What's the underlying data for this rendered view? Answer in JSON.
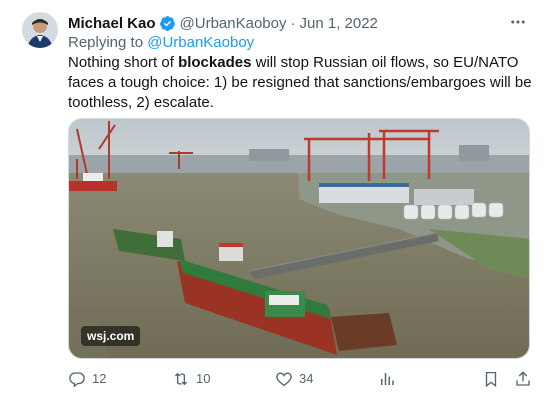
{
  "author": {
    "name": "Michael Kao",
    "handle": "@UrbanKaoboy",
    "separator": "·",
    "date": "Jun 1, 2022"
  },
  "reply": {
    "prefix": "Replying to",
    "mention": "@UrbanKaoboy"
  },
  "tweet": {
    "text_before": "Nothing short of ",
    "text_bold": "blockades",
    "text_after": " will stop Russian oil flows, so EU/NATO faces a tough choice: 1) be resigned that sanctions/embargoes will be toothless, 2) escalate."
  },
  "media": {
    "watermark": "wsj.com"
  },
  "actions": {
    "replies": "12",
    "retweets": "10",
    "likes": "34"
  },
  "colors": {
    "accent": "#1d9bf0",
    "muted": "#536471",
    "text": "#0f1419"
  },
  "icons": [
    "more-icon",
    "verified-icon",
    "reply-icon",
    "retweet-icon",
    "like-icon",
    "views-icon",
    "bookmark-icon",
    "share-icon"
  ]
}
